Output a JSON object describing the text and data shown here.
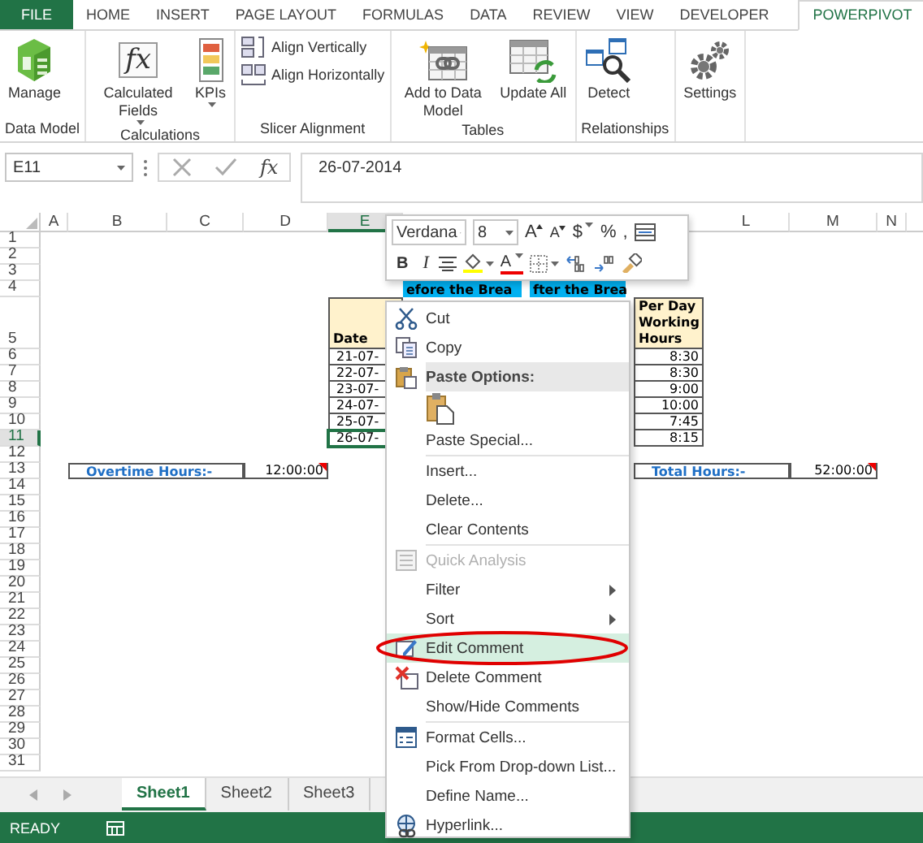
{
  "ribbon_tabs": [
    {
      "label": "FILE",
      "kind": "file",
      "selected": false
    },
    {
      "label": "HOME",
      "kind": "tab",
      "selected": false
    },
    {
      "label": "INSERT",
      "kind": "tab",
      "selected": false
    },
    {
      "label": "PAGE LAYOUT",
      "kind": "tab",
      "selected": false
    },
    {
      "label": "FORMULAS",
      "kind": "tab",
      "selected": false
    },
    {
      "label": "DATA",
      "kind": "tab",
      "selected": false
    },
    {
      "label": "REVIEW",
      "kind": "tab",
      "selected": false
    },
    {
      "label": "VIEW",
      "kind": "tab",
      "selected": false
    },
    {
      "label": "DEVELOPER",
      "kind": "tab",
      "selected": false
    },
    {
      "label": "POWERPIVOT",
      "kind": "tab",
      "selected": true
    }
  ],
  "ribbon_groups": [
    {
      "label": "Data Model",
      "commands": [
        {
          "label": "Manage",
          "kind": "large",
          "dropdown": false
        }
      ]
    },
    {
      "label": "Calculations",
      "commands": [
        {
          "label": "Calculated Fields",
          "kind": "large",
          "dropdown": true,
          "icon_text": "fx"
        },
        {
          "label": "KPIs",
          "kind": "large",
          "dropdown": true
        }
      ]
    },
    {
      "label": "Slicer Alignment",
      "commands": [
        {
          "label": "Align Vertically",
          "kind": "small",
          "dropdown": false
        },
        {
          "label": "Align Horizontally",
          "kind": "small",
          "dropdown": false
        }
      ]
    },
    {
      "label": "Tables",
      "commands": [
        {
          "label": "Add to Data Model",
          "kind": "large",
          "dropdown": false
        },
        {
          "label": "Update All",
          "kind": "large",
          "dropdown": false
        }
      ]
    },
    {
      "label": "Relationships",
      "commands": [
        {
          "label": "Detect",
          "kind": "large",
          "dropdown": false
        }
      ]
    },
    {
      "commands": [
        {
          "label": "Settings",
          "kind": "large",
          "dropdown": false
        }
      ]
    }
  ],
  "formula_bar": {
    "name_box": "E11",
    "function_label": "fx",
    "formula": "26-07-2014"
  },
  "sheet": {
    "columns": [
      {
        "label": "A",
        "selected": false
      },
      {
        "label": "B",
        "selected": false
      },
      {
        "label": "C",
        "selected": false
      },
      {
        "label": "D",
        "selected": false
      },
      {
        "label": "E",
        "selected": true
      },
      {
        "label": "L",
        "selected": false
      },
      {
        "label": "M",
        "selected": false
      },
      {
        "label": "N",
        "selected": false
      }
    ],
    "rows": [
      {
        "label": "1",
        "selected": false
      },
      {
        "label": "2",
        "selected": false
      },
      {
        "label": "3",
        "selected": false
      },
      {
        "label": "4",
        "selected": false
      },
      {
        "label": "5",
        "selected": false
      },
      {
        "label": "6",
        "selected": false
      },
      {
        "label": "7",
        "selected": false
      },
      {
        "label": "8",
        "selected": false
      },
      {
        "label": "9",
        "selected": false
      },
      {
        "label": "10",
        "selected": false
      },
      {
        "label": "11",
        "selected": true
      },
      {
        "label": "12",
        "selected": false
      },
      {
        "label": "13",
        "selected": false
      },
      {
        "label": "14",
        "selected": false
      },
      {
        "label": "15",
        "selected": false
      },
      {
        "label": "16",
        "selected": false
      },
      {
        "label": "17",
        "selected": false
      },
      {
        "label": "18",
        "selected": false
      },
      {
        "label": "19",
        "selected": false
      },
      {
        "label": "20",
        "selected": false
      },
      {
        "label": "21",
        "selected": false
      },
      {
        "label": "22",
        "selected": false
      },
      {
        "label": "23",
        "selected": false
      },
      {
        "label": "24",
        "selected": false
      },
      {
        "label": "25",
        "selected": false
      },
      {
        "label": "26",
        "selected": false
      },
      {
        "label": "27",
        "selected": false
      },
      {
        "label": "28",
        "selected": false
      },
      {
        "label": "29",
        "selected": false
      },
      {
        "label": "30",
        "selected": false
      },
      {
        "label": "31",
        "selected": false
      }
    ],
    "cells": [
      {
        "kind": "banner",
        "text": "efore the Brea",
        "selected": false
      },
      {
        "kind": "banner",
        "text": "fter the Brea",
        "selected": false
      },
      {
        "kind": "header",
        "text": "Date",
        "selected": false
      },
      {
        "kind": "header",
        "text": "Per Day Working Hours",
        "selected": false
      },
      {
        "kind": "date",
        "text": "21-07-",
        "selected": false
      },
      {
        "kind": "date",
        "text": "22-07-",
        "selected": false
      },
      {
        "kind": "date",
        "text": "23-07-",
        "selected": false
      },
      {
        "kind": "date",
        "text": "24-07-",
        "selected": false
      },
      {
        "kind": "date",
        "text": "25-07-",
        "selected": false
      },
      {
        "kind": "date",
        "text": "26-07-",
        "selected": true
      },
      {
        "kind": "number",
        "text": "8:30",
        "selected": false
      },
      {
        "kind": "number",
        "text": "8:30",
        "selected": false
      },
      {
        "kind": "number",
        "text": "9:00",
        "selected": false
      },
      {
        "kind": "number",
        "text": "10:00",
        "selected": false
      },
      {
        "kind": "number",
        "text": "7:45",
        "selected": false
      },
      {
        "kind": "number",
        "text": "8:15",
        "selected": false
      },
      {
        "kind": "label",
        "text": "Overtime Hours:-",
        "selected": false
      },
      {
        "kind": "number",
        "text": "12:00:00",
        "selected": false,
        "has_comment": true
      },
      {
        "kind": "label",
        "text": "Total Hours:-",
        "selected": false
      },
      {
        "kind": "number",
        "text": "52:00:00",
        "selected": false,
        "has_comment": true
      }
    ]
  },
  "mini_toolbar": {
    "font": "Verdana",
    "size": "8",
    "row_1": [
      {
        "kind": "grow",
        "label": "A"
      },
      {
        "kind": "shrink",
        "label": "A"
      },
      {
        "kind": "currency",
        "label": "$",
        "dropdown": true
      },
      {
        "kind": "percent",
        "label": "%"
      },
      {
        "kind": "comma",
        "label": ","
      },
      {
        "kind": "table"
      }
    ],
    "row_2": [
      {
        "kind": "bold",
        "label": "B"
      },
      {
        "kind": "italic",
        "label": "I"
      },
      {
        "kind": "align"
      },
      {
        "kind": "fill",
        "dropdown": true
      },
      {
        "kind": "fontcolor",
        "label": "A",
        "dropdown": true
      },
      {
        "kind": "borders",
        "dropdown": true
      },
      {
        "kind": "increase"
      },
      {
        "kind": "decrease"
      },
      {
        "kind": "painter"
      }
    ]
  },
  "context_menu": [
    {
      "kind": "command",
      "label": "Cut",
      "disabled": false,
      "submenu": false,
      "selected": false,
      "circled": false
    },
    {
      "kind": "command",
      "label": "Copy",
      "disabled": false,
      "submenu": false,
      "selected": false,
      "circled": false
    },
    {
      "kind": "section",
      "label": "Paste Options:"
    },
    {
      "kind": "paste-option"
    },
    {
      "kind": "command",
      "label": "Paste Special...",
      "disabled": false,
      "submenu": false,
      "selected": false,
      "circled": false
    },
    {
      "kind": "separator"
    },
    {
      "kind": "command",
      "label": "Insert...",
      "disabled": false,
      "submenu": false,
      "selected": false,
      "circled": false
    },
    {
      "kind": "command",
      "label": "Delete...",
      "disabled": false,
      "submenu": false,
      "selected": false,
      "circled": false
    },
    {
      "kind": "command",
      "label": "Clear Contents",
      "disabled": false,
      "submenu": false,
      "selected": false,
      "circled": false
    },
    {
      "kind": "separator"
    },
    {
      "kind": "command",
      "label": "Quick Analysis",
      "disabled": true,
      "submenu": false,
      "selected": false,
      "circled": false
    },
    {
      "kind": "command",
      "label": "Filter",
      "disabled": false,
      "submenu": true,
      "selected": false,
      "circled": false
    },
    {
      "kind": "command",
      "label": "Sort",
      "disabled": false,
      "submenu": true,
      "selected": false,
      "circled": false
    },
    {
      "kind": "command",
      "label": "Edit Comment",
      "disabled": false,
      "submenu": false,
      "selected": true,
      "circled": true
    },
    {
      "kind": "command",
      "label": "Delete Comment",
      "disabled": false,
      "submenu": false,
      "selected": false,
      "circled": false
    },
    {
      "kind": "command",
      "label": "Show/Hide Comments",
      "disabled": false,
      "submenu": false,
      "selected": false,
      "circled": false
    },
    {
      "kind": "separator"
    },
    {
      "kind": "command",
      "label": "Format Cells...",
      "disabled": false,
      "submenu": false,
      "selected": false,
      "circled": false
    },
    {
      "kind": "command",
      "label": "Pick From Drop-down List...",
      "disabled": false,
      "submenu": false,
      "selected": false,
      "circled": false
    },
    {
      "kind": "command",
      "label": "Define Name...",
      "disabled": false,
      "submenu": false,
      "selected": false,
      "circled": false
    },
    {
      "kind": "command",
      "label": "Hyperlink...",
      "disabled": false,
      "submenu": false,
      "selected": false,
      "circled": false
    }
  ],
  "sheet_tabs": [
    {
      "label": "Sheet1",
      "selected": true
    },
    {
      "label": "Sheet2",
      "selected": false
    },
    {
      "label": "Sheet3",
      "selected": false
    }
  ],
  "status_bar": {
    "mode": "READY"
  }
}
